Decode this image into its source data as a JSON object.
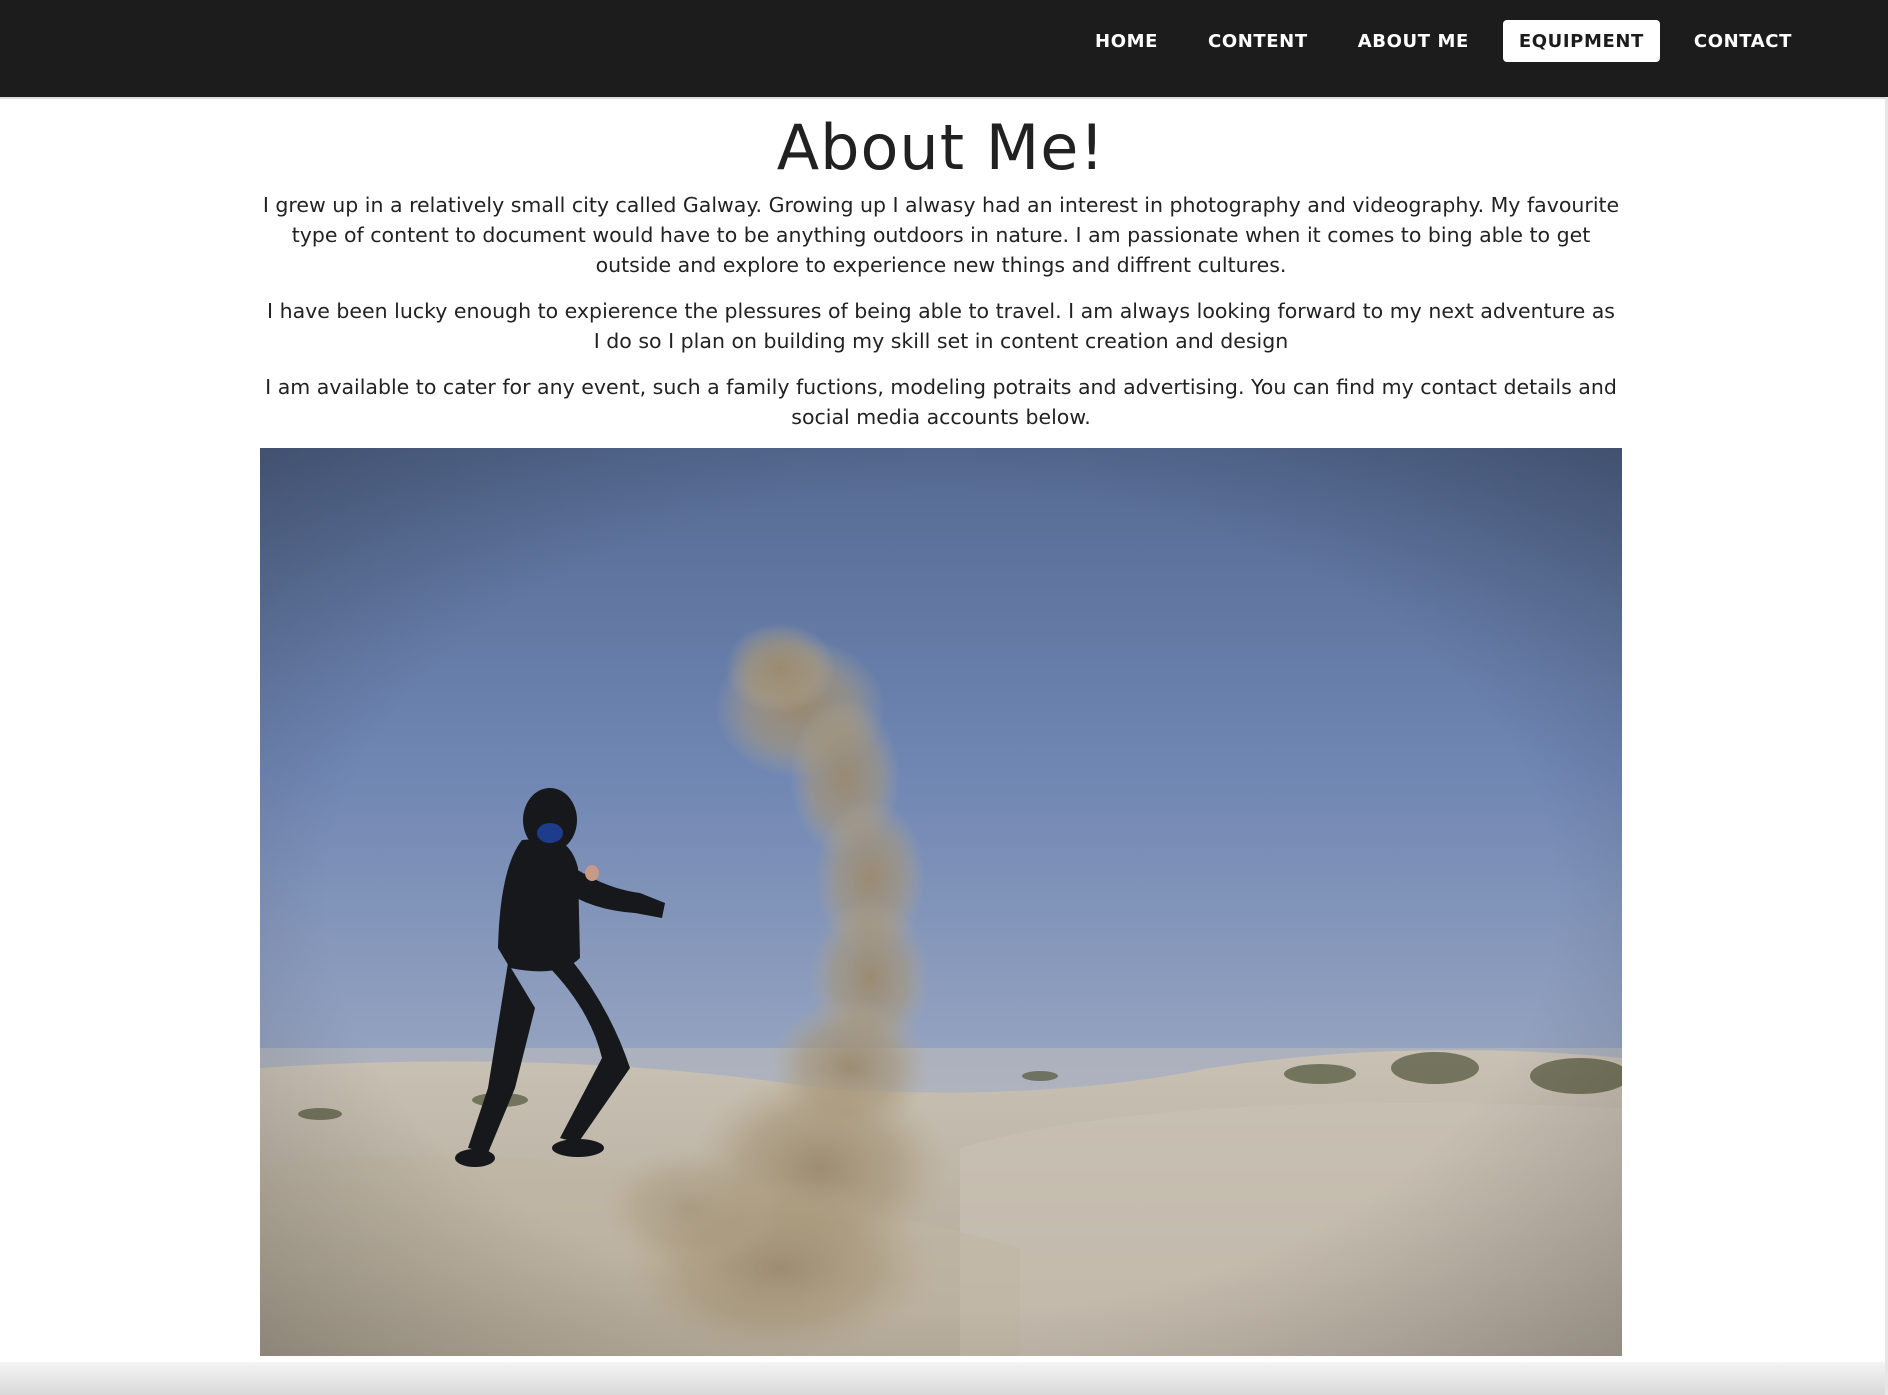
{
  "nav": {
    "items": [
      {
        "label": "HOME",
        "active": false
      },
      {
        "label": "CONTENT",
        "active": false
      },
      {
        "label": "ABOUT ME",
        "active": false
      },
      {
        "label": "EQUIPMENT",
        "active": true
      },
      {
        "label": "CONTACT",
        "active": false
      }
    ]
  },
  "main": {
    "title": "About Me!",
    "paragraphs": [
      "I grew up in a relatively small city called Galway. Growing up I alwasy had an interest in photography and videography. My favourite type of content to document would have to be anything outdoors in nature. I am passionate when it comes to bing able to get outside and explore to experience new things and diffrent cultures.",
      "I have been lucky enough to expierence the plessures of being able to travel. I am always looking forward to my next adventure as I do so I plan on building my skill set in content creation and design",
      "I am available to cater for any event, such a family fuctions, modeling potraits and advertising. You can find my contact details and social media accounts below."
    ],
    "photo": {
      "subject": "person in black hoodie throwing sand in a desert under blue sky"
    }
  },
  "colors": {
    "navbar_bg": "#1c1c1c",
    "nav_text": "#ffffff",
    "active_bg": "#ffffff",
    "body_text": "#222222"
  }
}
